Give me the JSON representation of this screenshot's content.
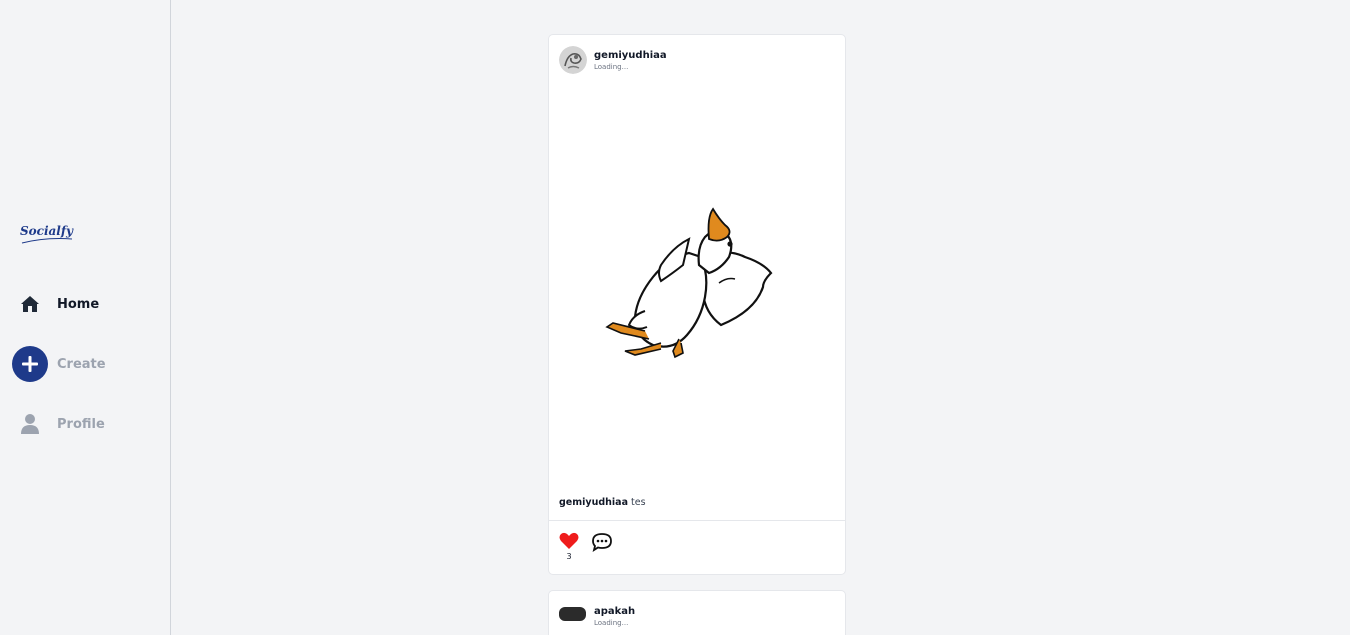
{
  "app": {
    "name": "Socialfy",
    "accent_color": "#1e3a8a"
  },
  "sidebar": {
    "items": [
      {
        "label": "Home",
        "icon": "home-icon",
        "active": true
      },
      {
        "label": "Create",
        "icon": "plus-icon",
        "active": false
      },
      {
        "label": "Profile",
        "icon": "user-icon",
        "active": false
      }
    ]
  },
  "feed": {
    "posts": [
      {
        "username": "gemiyudhiaa",
        "status": "Loading...",
        "caption_user": "gemiyudhiaa",
        "caption_text": "tes",
        "likes": "3",
        "liked": true,
        "like_color": "#ef1c1c"
      },
      {
        "username": "apakah",
        "status": "Loading..."
      }
    ]
  }
}
